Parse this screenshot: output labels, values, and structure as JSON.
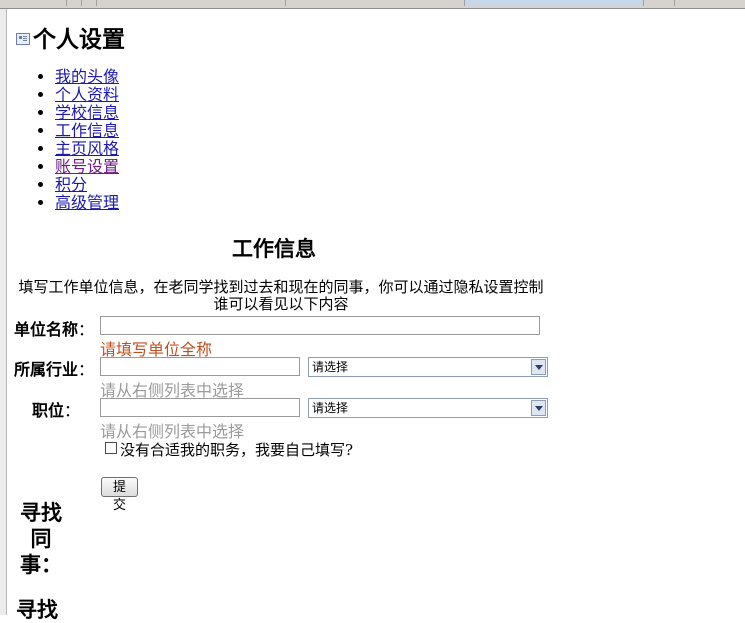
{
  "page_title": "个人设置",
  "nav": [
    {
      "label": "我的头像"
    },
    {
      "label": "个人资料"
    },
    {
      "label": "学校信息"
    },
    {
      "label": "工作信息"
    },
    {
      "label": "主页风格"
    },
    {
      "label": "账号设置"
    },
    {
      "label": "积分"
    },
    {
      "label": "高级管理"
    }
  ],
  "section_title": "工作信息",
  "description": "填写工作单位信息，在老同学找到过去和现在的同事，你可以通过隐私设置控制谁可以看见以下内容",
  "form": {
    "company": {
      "label": "单位名称",
      "colon": "：",
      "value": "",
      "hint": "请填写单位全称"
    },
    "industry": {
      "label": "所属行业",
      "colon": "：",
      "value": "",
      "select_value": "请选择",
      "hint": "请从右侧列表中选择"
    },
    "position": {
      "label": "职位",
      "colon": "：",
      "value": "",
      "select_value": "请选择",
      "hint": "请从右侧列表中选择"
    },
    "custom_position_checkbox": {
      "label": "没有合适我的职务，我要自己填写?",
      "checked": false
    },
    "submit_label": "提交"
  },
  "find_colleagues_title": "寻找同事：",
  "find_more_title": "寻找"
}
